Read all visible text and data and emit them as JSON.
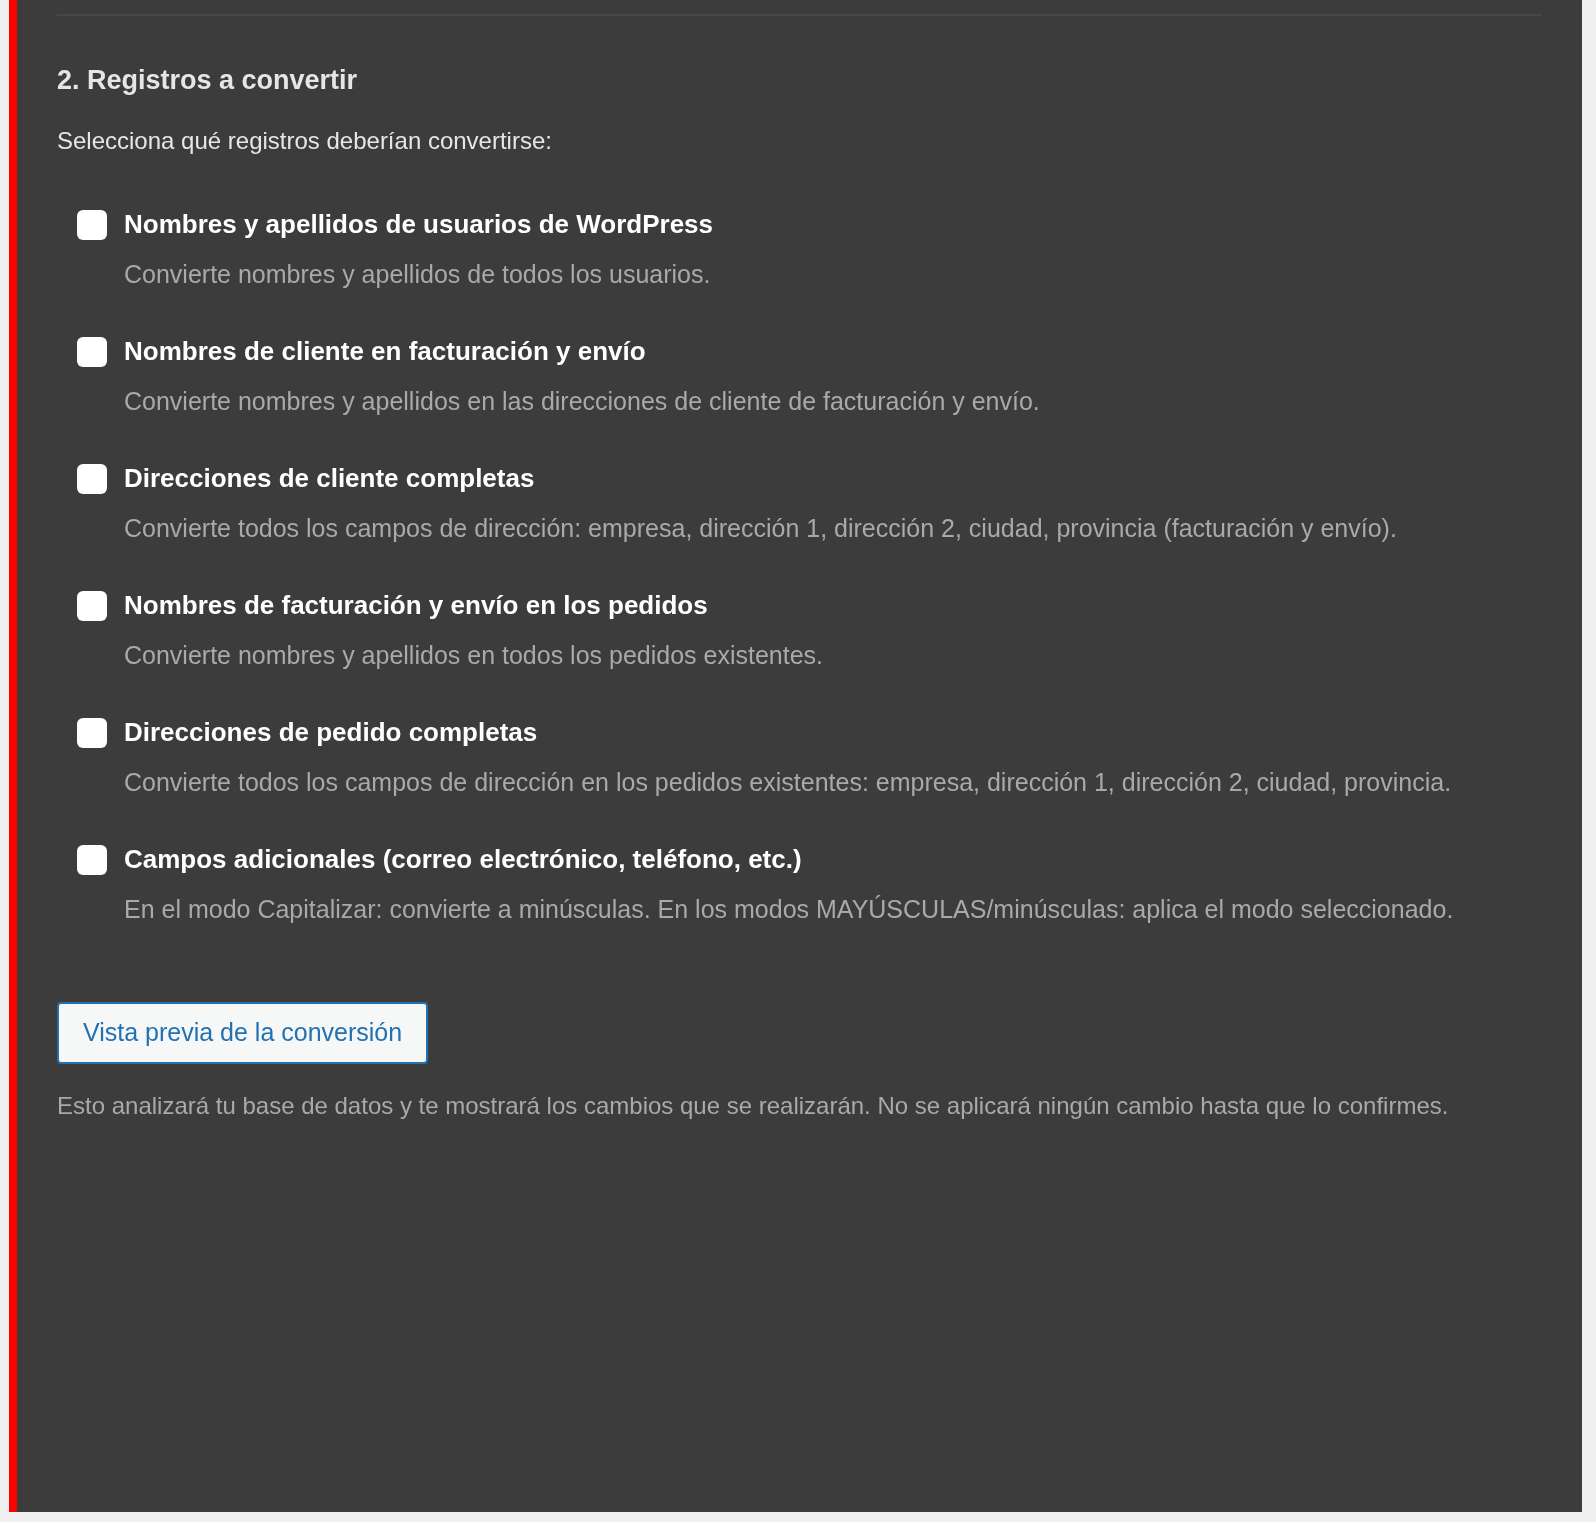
{
  "section": {
    "title": "2. Registros a convertir",
    "intro": "Selecciona qué registros deberían convertirse:"
  },
  "options": [
    {
      "label": "Nombres y apellidos de usuarios de WordPress",
      "description": "Convierte nombres y apellidos de todos los usuarios.",
      "checked": false
    },
    {
      "label": "Nombres de cliente en facturación y envío",
      "description": "Convierte nombres y apellidos en las direcciones de cliente de facturación y envío.",
      "checked": false
    },
    {
      "label": "Direcciones de cliente completas",
      "description": "Convierte todos los campos de dirección: empresa, dirección 1, dirección 2, ciudad, provincia (facturación y envío).",
      "checked": false
    },
    {
      "label": "Nombres de facturación y envío en los pedidos",
      "description": "Convierte nombres y apellidos en todos los pedidos existentes.",
      "checked": false
    },
    {
      "label": "Direcciones de pedido completas",
      "description": "Convierte todos los campos de dirección en los pedidos existentes: empresa, dirección 1, dirección 2, ciudad, provincia.",
      "checked": false
    },
    {
      "label": "Campos adicionales (correo electrónico, teléfono, etc.)",
      "description": "En el modo Capitalizar: convierte a minúsculas. En los modos MAYÚSCULAS/minúsculas: aplica el modo seleccionado.",
      "checked": false
    }
  ],
  "preview_button": "Vista previa de la conversión",
  "note": "Esto analizará tu base de datos y te mostrará los cambios que se realizarán. No se aplicará ningún cambio hasta que lo confirmes."
}
